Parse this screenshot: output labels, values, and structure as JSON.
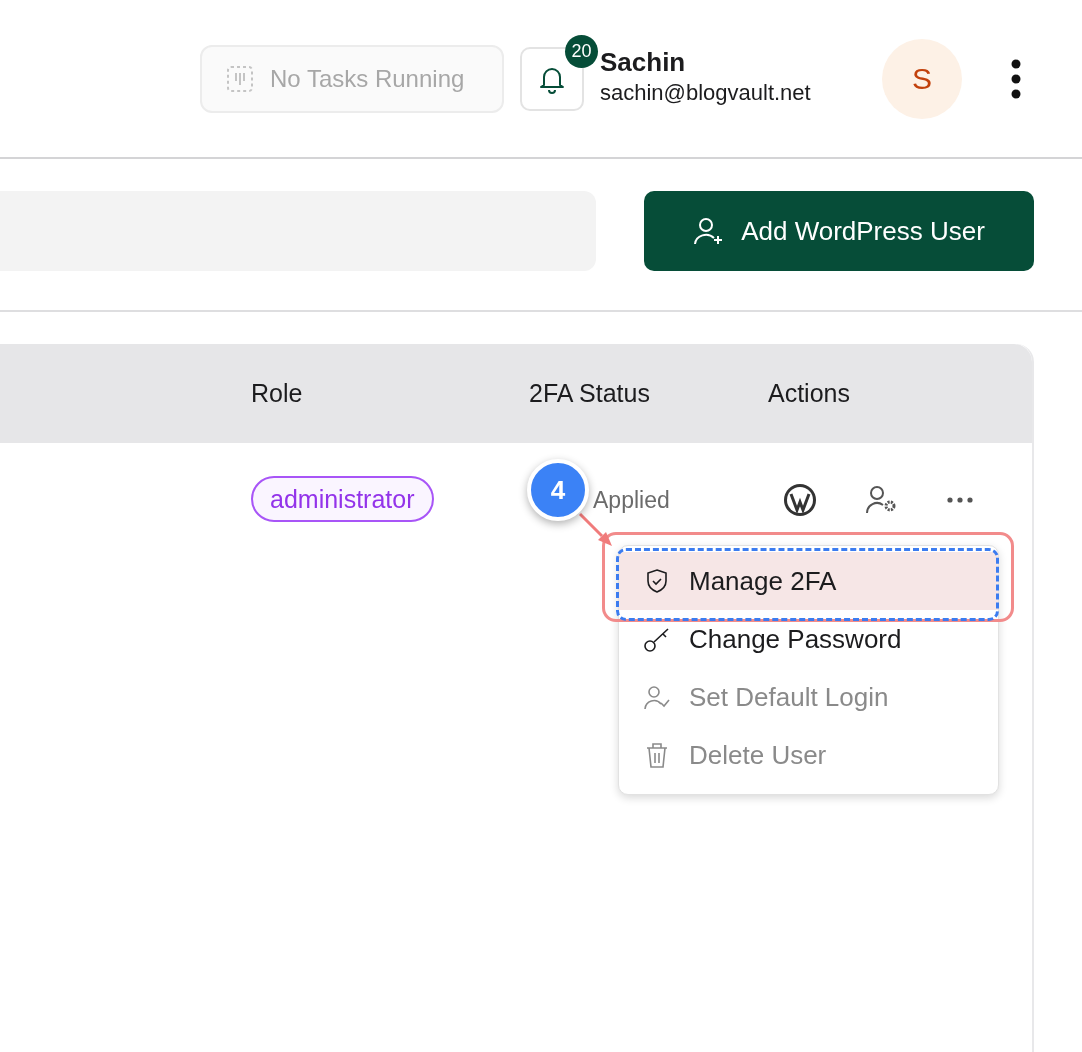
{
  "header": {
    "tasks_button": {
      "label": "No Tasks Running",
      "disabled": true
    },
    "notifications": {
      "count": "20"
    },
    "user": {
      "name": "Sachin",
      "email": "sachin@blogvault.net",
      "initial": "S"
    }
  },
  "toolbar": {
    "add_button": "Add WordPress User"
  },
  "table": {
    "columns": [
      "Role",
      "2FA Status",
      "Actions"
    ],
    "rows": [
      {
        "role": "administrator",
        "twofa_status": "Applied"
      }
    ]
  },
  "action_menu": {
    "items": [
      {
        "label": "Manage 2FA",
        "disabled": false,
        "highlighted": true
      },
      {
        "label": "Change Password",
        "disabled": false,
        "highlighted": false
      },
      {
        "label": "Set Default Login",
        "disabled": true,
        "highlighted": false
      },
      {
        "label": "Delete User",
        "disabled": true,
        "highlighted": false
      }
    ]
  },
  "annotation": {
    "step": "4"
  }
}
